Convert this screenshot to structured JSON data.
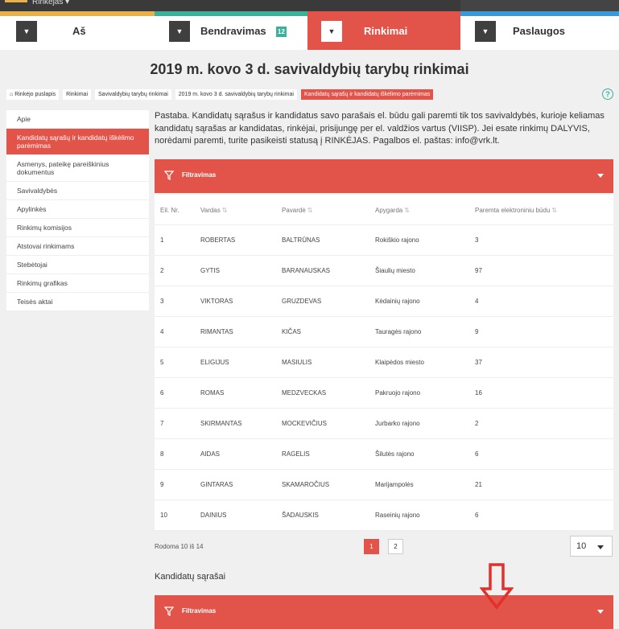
{
  "topbar": {
    "user_menu": "Rinkėjas ▾"
  },
  "tabs": [
    {
      "label": "Aš",
      "stripe": "#e8b14a"
    },
    {
      "label": "Bendravimas",
      "badge": "12",
      "stripe": "#3bb19b"
    },
    {
      "label": "Rinkimai",
      "stripe": "#e2544a"
    },
    {
      "label": "Paslaugos",
      "stripe": "#3a9ad9"
    }
  ],
  "page_title": "2019 m. kovo 3 d. savivaldybių tarybų rinkimai",
  "breadcrumb": [
    "Rinkėjo puslapis",
    "Rinkimai",
    "Savivaldybių tarybų rinkimai",
    "2019 m. kovo 3 d. savivaldybių tarybų rinkimai",
    "Kandidatų sąrašų ir kandidatų iškėlimo parėmimas"
  ],
  "help_label": "?",
  "sidebar": [
    "Apie",
    "Kandidatų sąrašų ir kandidatų iškėlimo parėmimas",
    "Asmenys, pateikę pareiškinius dokumentus",
    "Savivaldybės",
    "Apylinkės",
    "Rinkimų komisijos",
    "Atstovai rinkimams",
    "Stebėtojai",
    "Rinkimų grafikas",
    "Teisės aktai"
  ],
  "note": "Pastaba. Kandidatų sąrašus ir kandidatus savo parašais el. būdu gali paremti tik tos savivaldybės, kurioje keliamas kandidatų sąrašas ar kandidatas, rinkėjai, prisijungę per el. valdžios vartus (VIISP). Jei esate rinkimų DALYVIS, norėdami paremti, turite pasikeisti statusą į RINKĖJAS. Pagalbos el. paštas: info@vrk.lt.",
  "filter_label": "Filtravimas",
  "table": {
    "headers": [
      "Eil. Nr.",
      "Vardas",
      "Pavardė",
      "Apygarda",
      "Paremta elektroniniu būdu"
    ],
    "rows": [
      [
        "1",
        "ROBERTAS",
        "BALTRŪNAS",
        "Rokiškio rajono",
        "3"
      ],
      [
        "2",
        "GYTIS",
        "BARANAUSKAS",
        "Šiaulių miesto",
        "97"
      ],
      [
        "3",
        "VIKTORAS",
        "GRUZDEVAS",
        "Kėdainių rajono",
        "4"
      ],
      [
        "4",
        "RIMANTAS",
        "KIČAS",
        "Tauragės rajono",
        "9"
      ],
      [
        "5",
        "ELIGIJUS",
        "MASIULIS",
        "Klaipėdos miesto",
        "37"
      ],
      [
        "6",
        "ROMAS",
        "MEDZVECKAS",
        "Pakruojo rajono",
        "16"
      ],
      [
        "7",
        "SKIRMANTAS",
        "MOCKEVIČIUS",
        "Jurbarko rajono",
        "2"
      ],
      [
        "8",
        "AIDAS",
        "RAGELIS",
        "Šilutės rajono",
        "6"
      ],
      [
        "9",
        "GINTARAS",
        "SKAMAROČIUS",
        "Marijampolės",
        "21"
      ],
      [
        "10",
        "DAINIUS",
        "ŠADAUSKIS",
        "Raseinių rajono",
        "6"
      ]
    ]
  },
  "pagination": {
    "summary": "Rodoma 10 iš 14",
    "pages": [
      "1",
      "2"
    ],
    "per_page": "10"
  },
  "section2_title": "Kandidatų sąrašai",
  "filter2_label": "Filtravimas",
  "colors": {
    "accent": "#e2544a",
    "teal": "#3bb19b"
  }
}
